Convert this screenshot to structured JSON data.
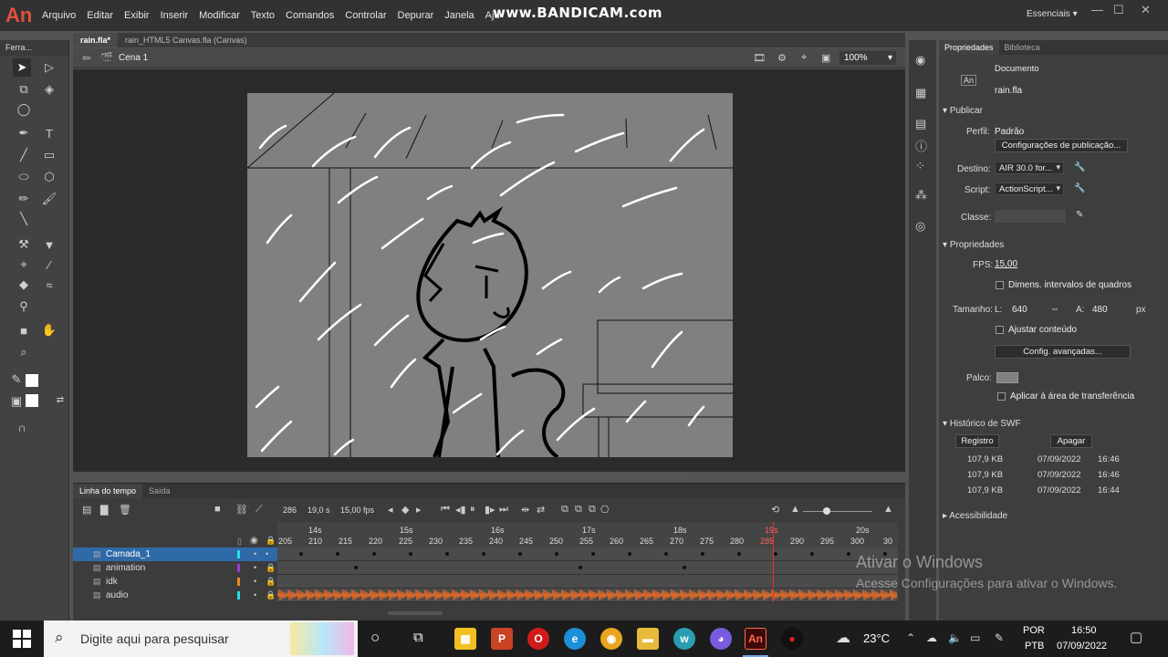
{
  "app": {
    "logo": "An",
    "watermark": "www.BANDICAM.com",
    "workspace": "Essenciais ▾"
  },
  "menu": [
    "Arquivo",
    "Editar",
    "Exibir",
    "Inserir",
    "Modificar",
    "Texto",
    "Comandos",
    "Controlar",
    "Depurar",
    "Janela",
    "Aju"
  ],
  "toolbar": {
    "title": "Ferra..."
  },
  "doc_tabs": [
    "rain.fla*",
    "rain_HTML5 Canvas.fla (Canvas)"
  ],
  "scene": {
    "label": "Cena 1",
    "zoom": "100%"
  },
  "timeline": {
    "tabs": [
      "Linha do tempo",
      "Saída"
    ],
    "current_frame": "286",
    "time": "19,0 s",
    "fps": "15,00 fps",
    "seconds": [
      "14s",
      "15s",
      "16s",
      "17s",
      "18s",
      "19s",
      "20s"
    ],
    "frame_numbers": [
      "205",
      "210",
      "215",
      "220",
      "225",
      "230",
      "235",
      "240",
      "245",
      "250",
      "255",
      "260",
      "265",
      "270",
      "275",
      "280",
      "285",
      "290",
      "295",
      "300",
      "30"
    ],
    "layers": [
      {
        "name": "Camada_1",
        "color": "#28e0e0"
      },
      {
        "name": "animation",
        "color": "#9b3fd6"
      },
      {
        "name": "idk",
        "color": "#f08a1a"
      },
      {
        "name": "audio",
        "color": "#28e0e0"
      }
    ]
  },
  "properties": {
    "tabs": [
      "Propriedades",
      "Biblioteca"
    ],
    "doc_type": "Documento",
    "doc_name": "rain.fla",
    "publish_title": "Publicar",
    "profile_label": "Perfil:",
    "profile_value": "Padrão",
    "publish_settings": "Configurações de publicação...",
    "target_label": "Destino:",
    "target_value": "AIR 30.0 for...",
    "script_label": "Script:",
    "script_value": "ActionScript...",
    "class_label": "Classe:",
    "props_title": "Propriedades",
    "fps_label": "FPS:",
    "fps_value": "15,00",
    "dimens_chk": "Dimens. intervalos de quadros",
    "size_label": "Tamanho:",
    "l_label": "L:",
    "width": "640",
    "a_label": "A:",
    "height": "480",
    "px": "px",
    "adjust_chk": "Ajustar conteúdo",
    "advanced": "Config. avançadas...",
    "stage_label": "Palco:",
    "stage_color": "#808080",
    "paste_chk": "Aplicar à área de transferência",
    "swf_title": "Histórico de SWF",
    "register": "Registro",
    "clear": "Apagar",
    "history": [
      {
        "size": "107,9 KB",
        "date": "07/09/2022",
        "time": "16:46"
      },
      {
        "size": "107,9 KB",
        "date": "07/09/2022",
        "time": "16:46"
      },
      {
        "size": "107,9 KB",
        "date": "07/09/2022",
        "time": "16:44"
      }
    ],
    "accessibility": "Acessibilidade"
  },
  "activation": {
    "title": "Ativar o Windows",
    "subtitle": "Acesse Configurações para ativar o Windows."
  },
  "taskbar": {
    "search_placeholder": "Digite aqui para pesquisar",
    "temperature": "23°C",
    "lang1": "POR",
    "lang2": "PTB",
    "time": "16:50",
    "date": "07/09/2022"
  }
}
